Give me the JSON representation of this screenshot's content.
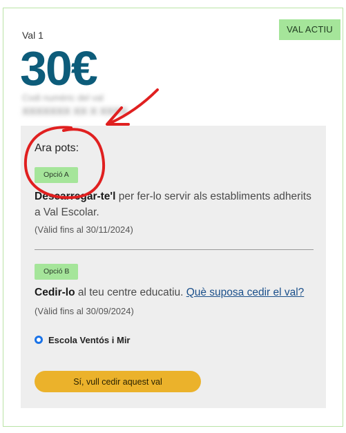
{
  "voucher": {
    "status_badge": "VAL ACTIU",
    "label": "Val 1",
    "amount": "30€",
    "code_label": "Codi numèric del val",
    "code_value": "XXXXXXX XX X XXXX"
  },
  "options": {
    "heading": "Ara pots:",
    "option_a": {
      "chip": "Opció A",
      "action": "Descarregar-te'l",
      "text": " per fer-lo servir als establiments adherits a Val Escolar.",
      "valid_until": "(Vàlid fins al 30/11/2024)"
    },
    "option_b": {
      "chip": "Opció B",
      "action": "Cedir-lo",
      "text": " al teu centre educatiu. ",
      "link": "Què suposa cedir el val?",
      "valid_until": "(Vàlid fins al 30/09/2024)",
      "school": "Escola Ventós i Mir"
    },
    "cta_label": "Sí, vull cedir aquest val"
  },
  "colors": {
    "amount": "#0d5c7a",
    "badge": "#a5e59a",
    "card_border": "#b9e3a5",
    "cta": "#ebb22b",
    "annotation": "#e02020",
    "link": "#1a4f8a",
    "radio": "#1a73e8"
  }
}
